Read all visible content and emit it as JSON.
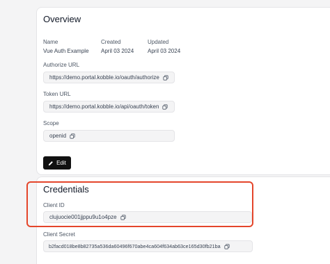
{
  "overview": {
    "title": "Overview",
    "meta": {
      "name_label": "Name",
      "name_value": "Vue Auth Example",
      "created_label": "Created",
      "created_value": "April 03 2024",
      "updated_label": "Updated",
      "updated_value": "April 03 2024"
    },
    "authorize_url_label": "Authorize URL",
    "authorize_url": "https://demo.portal.kobble.io/oauth/authorize",
    "token_url_label": "Token URL",
    "token_url": "https://demo.portal.kobble.io/api/oauth/token",
    "scope_label": "Scope",
    "scope": "openid",
    "edit_label": "Edit"
  },
  "credentials": {
    "title": "Credentials",
    "client_id_label": "Client ID",
    "client_id": "clujuocie001jjppu9u1o4pze",
    "client_secret_label": "Client Secret",
    "client_secret": "b2facd018be8b82735a536da60496f670abe4ca604f634ab63ce165d30fb21ba"
  },
  "colors": {
    "highlight": "#e4452a",
    "button_bg": "#111111"
  }
}
